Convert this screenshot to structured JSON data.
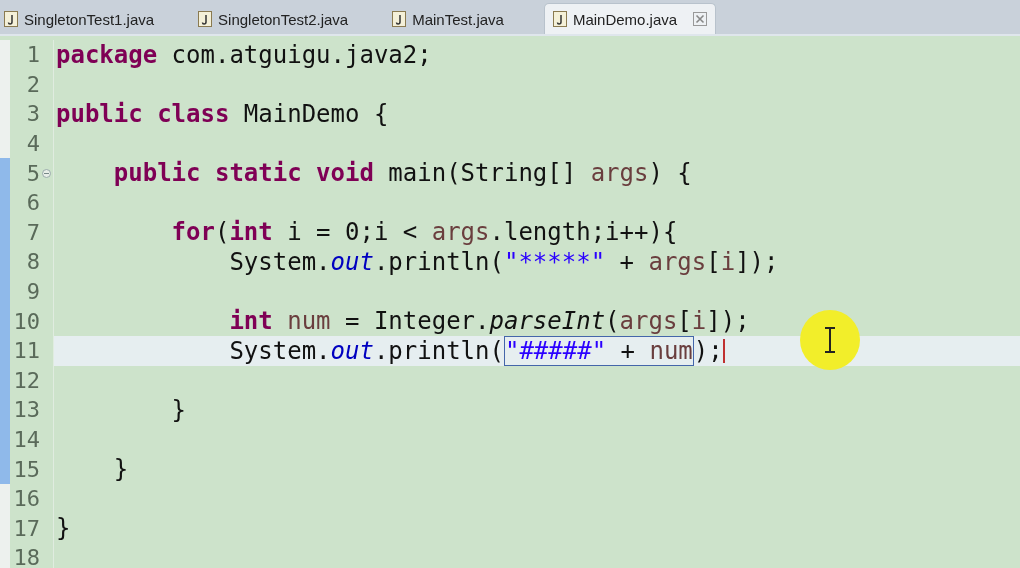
{
  "tabs": [
    {
      "label": "SingletonTest1.java",
      "selected": false
    },
    {
      "label": "SingletonTest2.java",
      "selected": false
    },
    {
      "label": "MainTest.java",
      "selected": false
    },
    {
      "label": "MainDemo.java",
      "selected": true
    }
  ],
  "lines": [
    {
      "number": "1",
      "current": false,
      "range": false,
      "fold": false,
      "tokens": [
        {
          "kind": "keyword",
          "text": "package "
        },
        {
          "kind": "plain",
          "text": "com.atguigu.java2;"
        }
      ]
    },
    {
      "number": "2",
      "current": false,
      "range": false,
      "fold": false
    },
    {
      "number": "3",
      "current": false,
      "range": false,
      "fold": false,
      "tokens": [
        {
          "kind": "keyword",
          "text": "public "
        },
        {
          "kind": "keyword",
          "text": "class "
        },
        {
          "kind": "plain",
          "text": "MainDemo {"
        }
      ]
    },
    {
      "number": "4",
      "current": false,
      "range": false,
      "fold": false
    },
    {
      "number": "5",
      "current": false,
      "range": true,
      "fold": true,
      "tokens": [
        {
          "kind": "keyword",
          "text": "    public "
        },
        {
          "kind": "keyword",
          "text": "static "
        },
        {
          "kind": "keyword",
          "text": "void "
        },
        {
          "kind": "plain",
          "text": "main(String[] "
        },
        {
          "kind": "variable",
          "text": "args"
        },
        {
          "kind": "plain",
          "text": ") {"
        }
      ]
    },
    {
      "number": "6",
      "current": false,
      "range": true,
      "fold": false
    },
    {
      "number": "7",
      "current": false,
      "range": true,
      "fold": false,
      "tokens": [
        {
          "kind": "keyword",
          "text": "        for"
        },
        {
          "kind": "plain",
          "text": "("
        },
        {
          "kind": "keyword",
          "text": "int"
        },
        {
          "kind": "plain",
          "text": " i = 0;i < "
        },
        {
          "kind": "variable",
          "text": "args"
        },
        {
          "kind": "plain",
          "text": ".length;i++){"
        }
      ]
    },
    {
      "number": "8",
      "current": false,
      "range": true,
      "fold": false,
      "tokens": [
        {
          "kind": "plain",
          "text": "            System."
        },
        {
          "kind": "field",
          "text": "out"
        },
        {
          "kind": "plain",
          "text": ".println("
        },
        {
          "kind": "string",
          "text": "\"*****\""
        },
        {
          "kind": "plain",
          "text": " + "
        },
        {
          "kind": "variable",
          "text": "args"
        },
        {
          "kind": "plain",
          "text": "["
        },
        {
          "kind": "variable",
          "text": "i"
        },
        {
          "kind": "plain",
          "text": "]);"
        }
      ]
    },
    {
      "number": "9",
      "current": false,
      "range": true,
      "fold": false
    },
    {
      "number": "10",
      "current": false,
      "range": true,
      "fold": false,
      "tokens": [
        {
          "kind": "keyword",
          "text": "            int "
        },
        {
          "kind": "variable",
          "text": "num"
        },
        {
          "kind": "plain",
          "text": " = Integer."
        },
        {
          "kind": "static",
          "text": "parseInt"
        },
        {
          "kind": "plain",
          "text": "("
        },
        {
          "kind": "variable",
          "text": "args"
        },
        {
          "kind": "plain",
          "text": "["
        },
        {
          "kind": "variable",
          "text": "i"
        },
        {
          "kind": "plain",
          "text": "]);"
        }
      ]
    },
    {
      "number": "11",
      "current": true,
      "range": true,
      "fold": false,
      "tokens": [
        {
          "kind": "plain",
          "text": "            System."
        },
        {
          "kind": "field",
          "text": "out"
        },
        {
          "kind": "plain",
          "text": ".println("
        },
        {
          "kind": "box",
          "tokens": [
            {
              "kind": "string",
              "text": "\"#####\""
            },
            {
              "kind": "plain",
              "text": " + "
            },
            {
              "kind": "variable",
              "text": "num"
            }
          ]
        },
        {
          "kind": "plain",
          "text": ");"
        }
      ]
    },
    {
      "number": "12",
      "current": false,
      "range": true,
      "fold": false
    },
    {
      "number": "13",
      "current": false,
      "range": true,
      "fold": false,
      "tokens": [
        {
          "kind": "plain",
          "text": "        }"
        }
      ]
    },
    {
      "number": "14",
      "current": false,
      "range": true,
      "fold": false
    },
    {
      "number": "15",
      "current": false,
      "range": true,
      "fold": false,
      "tokens": [
        {
          "kind": "plain",
          "text": "    }"
        }
      ]
    },
    {
      "number": "16",
      "current": false,
      "range": false,
      "fold": false
    },
    {
      "number": "17",
      "current": false,
      "range": false,
      "fold": false,
      "tokens": [
        {
          "kind": "plain",
          "text": "}"
        }
      ]
    },
    {
      "number": "18",
      "current": false,
      "range": false,
      "fold": false
    }
  ]
}
